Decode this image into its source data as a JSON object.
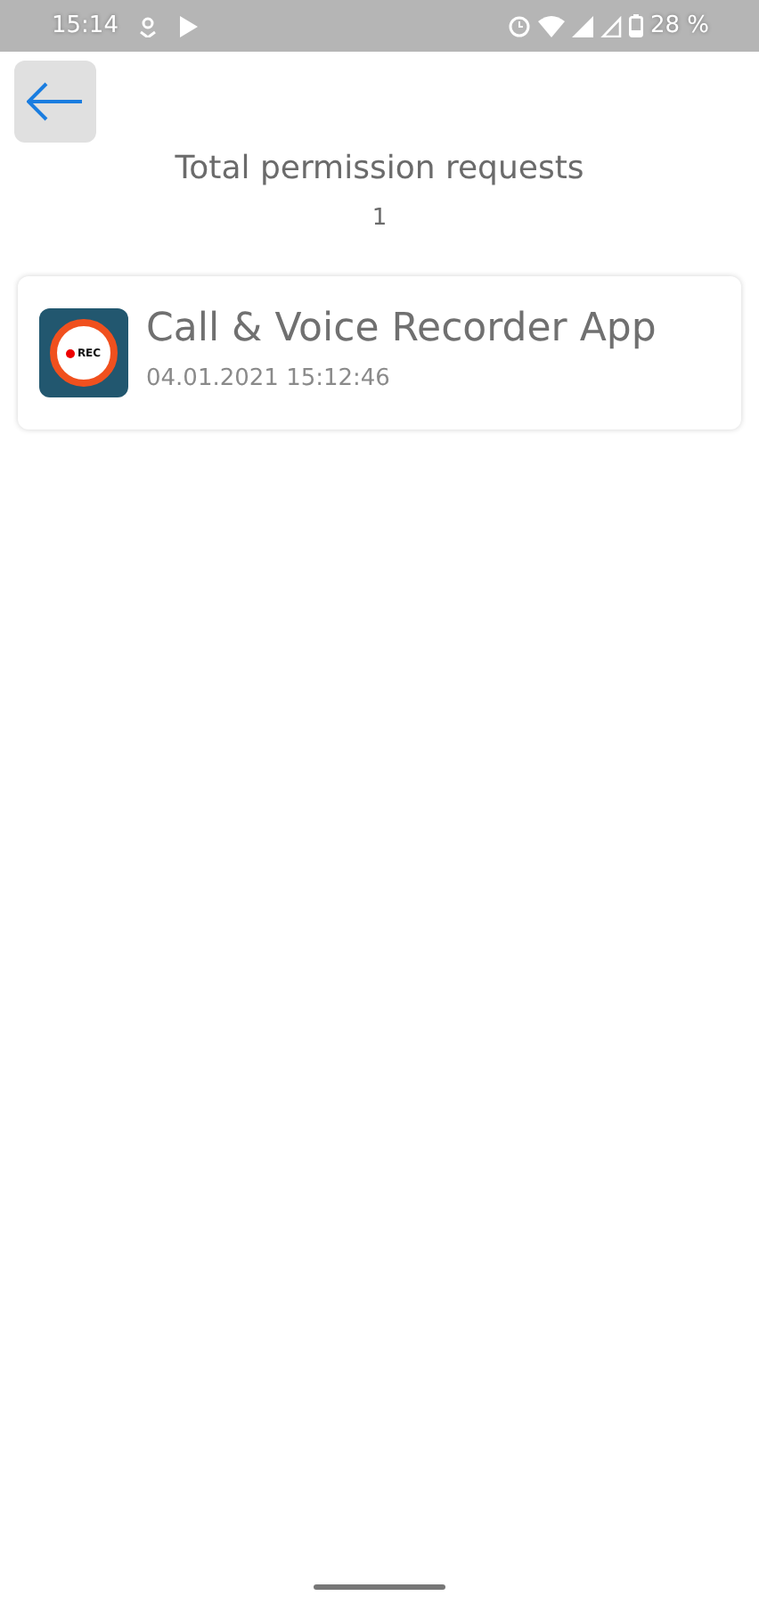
{
  "status_bar": {
    "time": "15:14",
    "battery": "28 %"
  },
  "header": {
    "title": "Total permission requests",
    "count": "1"
  },
  "apps": [
    {
      "name": "Call & Voice Recorder App",
      "date": "04.01.2021 15:12:46",
      "icon_label": "REC"
    }
  ]
}
